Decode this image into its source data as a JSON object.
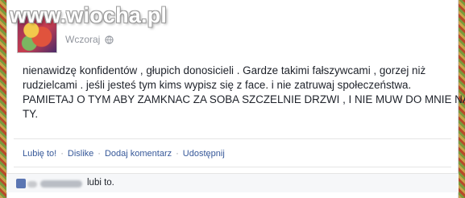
{
  "watermark": "www.wiocha.pl",
  "post": {
    "timestamp": "Wczoraj",
    "privacy_icon": "globe-icon",
    "lines": [
      "nienawidzę konfidentów , głupich donosicieli . Gardze takimi fałszywcami , gorzej niż",
      "rudzielcami . jeśli jesteś tym kims wypisz się z face. i nie zatruwaj społeczeństwa.",
      "PAMIETAJ O TYM ABY ZAMKNAC ZA SOBA SZCZELNIE DRZWI , I NIE MUW DO MNIE NA",
      "TY."
    ]
  },
  "actions": {
    "like": "Lubię to!",
    "dislike": "Dislike",
    "comment": "Dodaj komentarz",
    "share": "Udostępnij",
    "separator": "·"
  },
  "likes": {
    "suffix": "lubi to."
  },
  "colors": {
    "link": "#365899",
    "text": "#1d2129",
    "muted": "#90949c"
  }
}
